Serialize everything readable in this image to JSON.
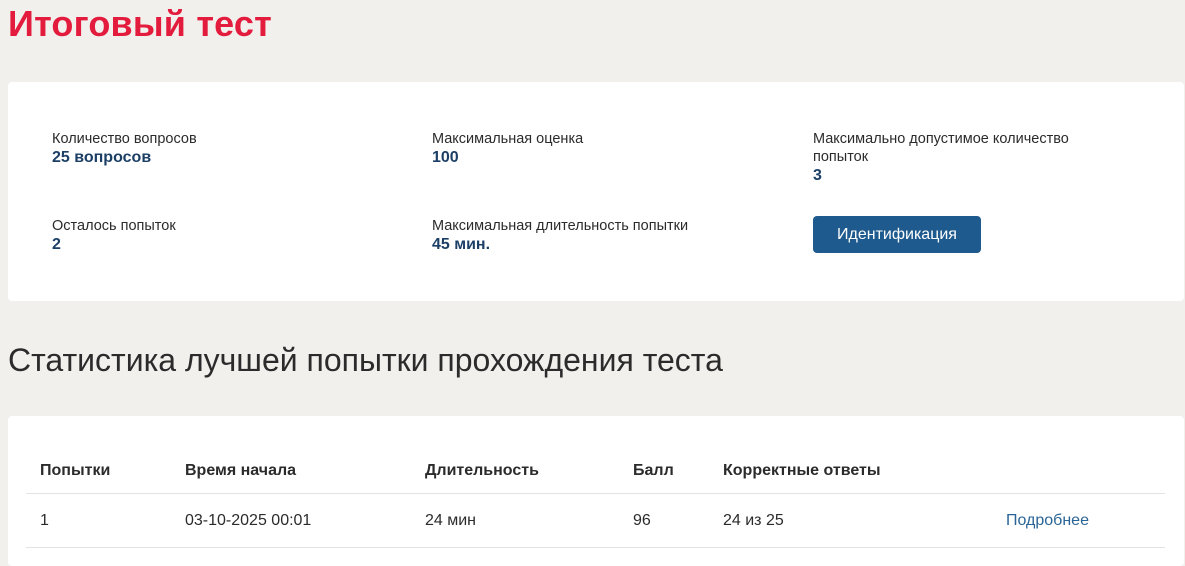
{
  "page": {
    "title": "Итоговый тест"
  },
  "info": {
    "questions_label": "Количество вопросов",
    "questions_value": "25 вопросов",
    "max_score_label": "Максимальная оценка",
    "max_score_value": "100",
    "max_attempts_label": "Максимально допустимое количество попыток",
    "max_attempts_value": "3",
    "remaining_label": "Осталось попыток",
    "remaining_value": "2",
    "max_duration_label": "Максимальная длительность попытки",
    "max_duration_value": "45 мин.",
    "identify_button": "Идентификация"
  },
  "stats": {
    "title": "Статистика лучшей попытки прохождения теста",
    "columns": [
      "Попытки",
      "Время начала",
      "Длительность",
      "Балл",
      "Корректные ответы",
      ""
    ],
    "rows": [
      {
        "attempt": "1",
        "start_time": "03-10-2025 00:01",
        "duration": "24 мин",
        "score": "96",
        "correct": "24 из 25",
        "details_link": "Подробнее"
      }
    ]
  },
  "colors": {
    "title_red": "#e31b3d",
    "value_blue": "#1c3f66",
    "button_blue": "#1e5a8e",
    "link_blue": "#2a6496",
    "page_bg": "#f2f0ed"
  }
}
